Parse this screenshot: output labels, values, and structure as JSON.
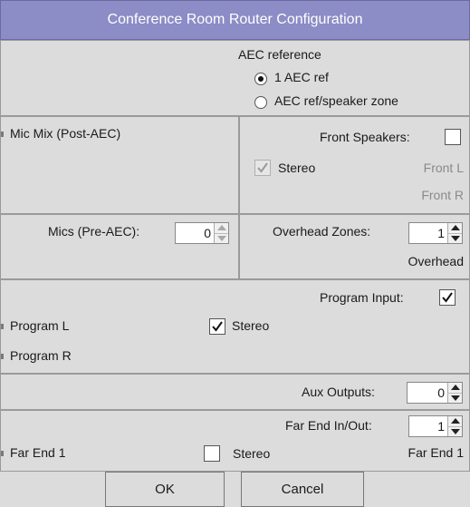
{
  "window": {
    "title": "Conference Room Router Configuration"
  },
  "aec": {
    "heading": "AEC reference",
    "options": [
      {
        "label": "1 AEC ref",
        "selected": true
      },
      {
        "label": "AEC ref/speaker zone",
        "selected": false
      }
    ]
  },
  "mic_mix": {
    "label": "Mic Mix (Post-AEC)"
  },
  "front_speakers": {
    "label": "Front Speakers:",
    "checked": false,
    "stereo_label": "Stereo",
    "stereo_checked": true,
    "stereo_enabled": false,
    "outputs": [
      "Front L",
      "Front R"
    ]
  },
  "mics": {
    "label": "Mics (Pre-AEC):",
    "value": "0"
  },
  "overhead": {
    "label": "Overhead Zones:",
    "value": "1",
    "output": "Overhead"
  },
  "program": {
    "label": "Program Input:",
    "checked": true,
    "inputs": [
      "Program L",
      "Program R"
    ],
    "stereo_label": "Stereo",
    "stereo_checked": true
  },
  "aux": {
    "label": "Aux Outputs:",
    "value": "0"
  },
  "far_end": {
    "label": "Far End In/Out:",
    "value": "1",
    "input": "Far End 1",
    "stereo_label": "Stereo",
    "stereo_checked": false,
    "output": "Far End 1"
  },
  "buttons": {
    "ok": "OK",
    "cancel": "Cancel"
  },
  "icons": {
    "spin_up": "triangle-up-icon",
    "spin_down": "triangle-down-icon",
    "check": "checkmark-icon",
    "pin": "connector-pin-icon"
  }
}
